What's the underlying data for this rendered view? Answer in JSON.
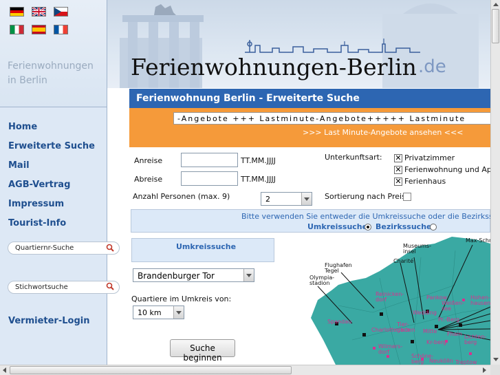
{
  "flags": [
    {
      "icon": "german-flag-icon"
    },
    {
      "icon": "uk-flag-icon"
    },
    {
      "icon": "czech-flag-icon"
    },
    {
      "icon": "italian-flag-icon"
    },
    {
      "icon": "spanish-flag-icon"
    },
    {
      "icon": "french-flag-icon"
    }
  ],
  "left": {
    "title_line1": "Ferienwohnungen",
    "title_line2": "in Berlin"
  },
  "nav": {
    "home": "Home",
    "advanced": "Erweiterte Suche",
    "mail": "Mail",
    "agb": "AGB-Vertrag",
    "impressum": "Impressum",
    "tourist": "Tourist-Info",
    "quartier_placeholder": "Quartiernr-Suche",
    "keyword_placeholder": "Stichwortsuche",
    "login": "Vermieter-Login"
  },
  "header": {
    "brand": "Ferienwohnungen-Berlin",
    "tld": ".de",
    "subtitle": "Ferienwohnung Berlin - Erweiterte Suche"
  },
  "offers": {
    "marquee": "-Angebote +++ Lastminute-Angebote+++++ Lastminute",
    "link": ">>> Last Minute-Angebote ansehen <<<"
  },
  "form": {
    "arrival_label": "Anreise",
    "arrival_value": "",
    "departure_label": "Abreise",
    "departure_value": "",
    "date_format": "TT.MM.JJJJ",
    "persons_label": "Anzahl Personen (max. 9)",
    "persons_value": "2",
    "type_label": "Unterkunftsart:",
    "type_options": [
      "Privatzimmer",
      "Ferienwohnung und Apartment",
      "Ferienhaus"
    ],
    "sort_label": "Sortierung nach Preis",
    "info_text": "Bitte verwenden Sie entweder die Umkreissuche oder die Bezirkssuche",
    "umkreis_option": "Umkreissuche",
    "bezirk_option": "Bezirkssuche",
    "umkreis_title": "Umkreissuche",
    "landmark_value": "Brandenburger Tor",
    "radius_label": "Quartiere im Umkreis von:",
    "radius_value": "10 km",
    "submit": "Suche beginnen"
  },
  "map": {
    "callouts": [
      "Max-Schmeling Halle",
      "Museums-insel",
      "Charité",
      "Flughafen Tegel",
      "Olympia-stadion"
    ],
    "districts": [
      "Reinicken-dorf",
      "Pankow",
      "Weißen-see",
      "Hohen-hausen",
      "Spandau",
      "Wedding",
      "Tier-garten",
      "Pr.-Berg",
      "Charlottenburg",
      "Mitte",
      "Fhain",
      "Lichten-berg",
      "Kr-berg",
      "Wilmers-dorf",
      "Schöne-berg",
      "Neukölln",
      "Treptow"
    ]
  },
  "colors": {
    "nav_blue": "#1f4f8f",
    "header_bar": "#2d66b2",
    "offers_orange": "#f59a3a",
    "map_teal": "#3aa9a3",
    "district_label": "#d6338f"
  }
}
